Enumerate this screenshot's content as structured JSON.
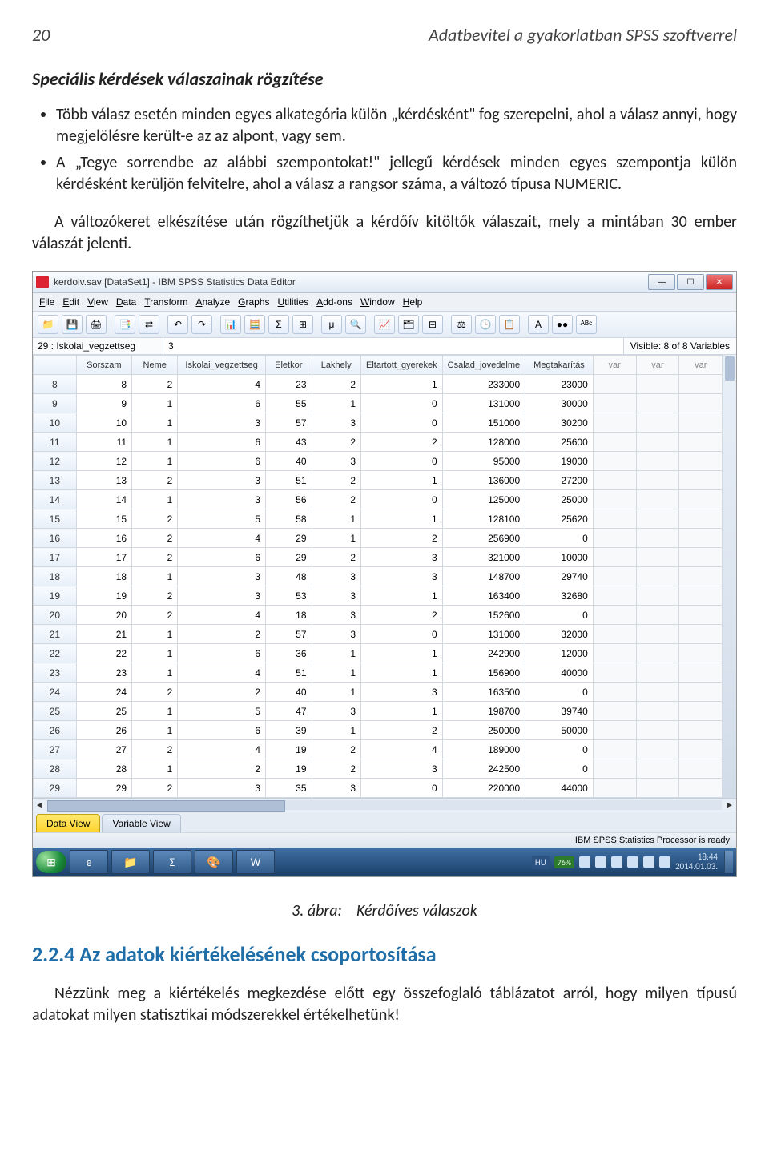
{
  "page": {
    "number": "20",
    "running_head": "Adatbevitel a gyakorlatban SPSS szoftverrel"
  },
  "text": {
    "section_title": "Speciális kérdések válaszainak rögzítése",
    "bullet1": "Több válasz esetén minden egyes alkategória külön „kérdésként\" fog szerepelni, ahol a válasz annyi, hogy megjelölésre került-e az az alpont, vagy sem.",
    "bullet2": "A „Tegye sorrendbe az alábbi szempontokat!\" jellegű kérdések minden egyes szempontja külön kérdésként kerüljön felvitelre, ahol a válasz a rangsor száma, a változó típusa NUMERIC.",
    "para1": "A változókeret elkészítése után rögzíthetjük a kérdőív kitöltők válaszait, mely a mintában 30 ember válaszát jelenti.",
    "figure_caption_label": "3. ábra:",
    "figure_caption_text": "Kérdőíves válaszok",
    "h2": "2.2.4  Az adatok kiértékelésének csoportosítása",
    "para2": "Nézzünk meg a kiértékelés megkezdése előtt egy összefoglaló táblázatot arról, hogy milyen típusú adatokat milyen statisztikai módszerekkel értékelhetünk!"
  },
  "spss": {
    "window_title": "kerdoiv.sav [DataSet1] - IBM SPSS Statistics Data Editor",
    "menus": [
      "File",
      "Edit",
      "View",
      "Data",
      "Transform",
      "Analyze",
      "Graphs",
      "Utilities",
      "Add-ons",
      "Window",
      "Help"
    ],
    "toolbar_icons": [
      "📁",
      "💾",
      "🖨",
      "📑",
      "⇄",
      "↶",
      "↷",
      "📊",
      "🧮",
      "Σ",
      "⊞",
      "μ",
      "🔍",
      "📈",
      "🗂",
      "⊟",
      "⚖",
      "🕒",
      "📋",
      "A",
      "●●",
      "ᴬᴮᶜ"
    ],
    "active_cell_name": "29 : Iskolai_vegzettseg",
    "active_cell_value": "3",
    "visible_info": "Visible: 8 of 8 Variables",
    "columns": [
      "Sorszam",
      "Neme",
      "Iskolai_vegzettseg",
      "Eletkor",
      "Lakhely",
      "Eltartott_gyerekek",
      "Csalad_jovedelme",
      "Megtakarítás"
    ],
    "extra_var_cols": 3,
    "rows": [
      {
        "n": "8",
        "c": [
          8,
          2,
          4,
          23,
          2,
          1,
          233000,
          23000
        ]
      },
      {
        "n": "9",
        "c": [
          9,
          1,
          6,
          55,
          1,
          0,
          131000,
          30000
        ]
      },
      {
        "n": "10",
        "c": [
          10,
          1,
          3,
          57,
          3,
          0,
          151000,
          30200
        ]
      },
      {
        "n": "11",
        "c": [
          11,
          1,
          6,
          43,
          2,
          2,
          128000,
          25600
        ]
      },
      {
        "n": "12",
        "c": [
          12,
          1,
          6,
          40,
          3,
          0,
          95000,
          19000
        ]
      },
      {
        "n": "13",
        "c": [
          13,
          2,
          3,
          51,
          2,
          1,
          136000,
          27200
        ]
      },
      {
        "n": "14",
        "c": [
          14,
          1,
          3,
          56,
          2,
          0,
          125000,
          25000
        ]
      },
      {
        "n": "15",
        "c": [
          15,
          2,
          5,
          58,
          1,
          1,
          128100,
          25620
        ]
      },
      {
        "n": "16",
        "c": [
          16,
          2,
          4,
          29,
          1,
          2,
          256900,
          0
        ]
      },
      {
        "n": "17",
        "c": [
          17,
          2,
          6,
          29,
          2,
          3,
          321000,
          10000
        ]
      },
      {
        "n": "18",
        "c": [
          18,
          1,
          3,
          48,
          3,
          3,
          148700,
          29740
        ]
      },
      {
        "n": "19",
        "c": [
          19,
          2,
          3,
          53,
          3,
          1,
          163400,
          32680
        ]
      },
      {
        "n": "20",
        "c": [
          20,
          2,
          4,
          18,
          3,
          2,
          152600,
          0
        ]
      },
      {
        "n": "21",
        "c": [
          21,
          1,
          2,
          57,
          3,
          0,
          131000,
          32000
        ]
      },
      {
        "n": "22",
        "c": [
          22,
          1,
          6,
          36,
          1,
          1,
          242900,
          12000
        ]
      },
      {
        "n": "23",
        "c": [
          23,
          1,
          4,
          51,
          1,
          1,
          156900,
          40000
        ]
      },
      {
        "n": "24",
        "c": [
          24,
          2,
          2,
          40,
          1,
          3,
          163500,
          0
        ]
      },
      {
        "n": "25",
        "c": [
          25,
          1,
          5,
          47,
          3,
          1,
          198700,
          39740
        ]
      },
      {
        "n": "26",
        "c": [
          26,
          1,
          6,
          39,
          1,
          2,
          250000,
          50000
        ]
      },
      {
        "n": "27",
        "c": [
          27,
          2,
          4,
          19,
          2,
          4,
          189000,
          0
        ]
      },
      {
        "n": "28",
        "c": [
          28,
          1,
          2,
          19,
          2,
          3,
          242500,
          0
        ]
      },
      {
        "n": "29",
        "c": [
          29,
          2,
          3,
          35,
          3,
          0,
          220000,
          44000
        ]
      }
    ],
    "tabs": {
      "data_view": "Data View",
      "variable_view": "Variable View"
    },
    "status": "IBM SPSS Statistics Processor is ready"
  },
  "taskbar": {
    "lang": "HU",
    "battery": "76%",
    "time": "18:44",
    "date": "2014.01.03."
  }
}
